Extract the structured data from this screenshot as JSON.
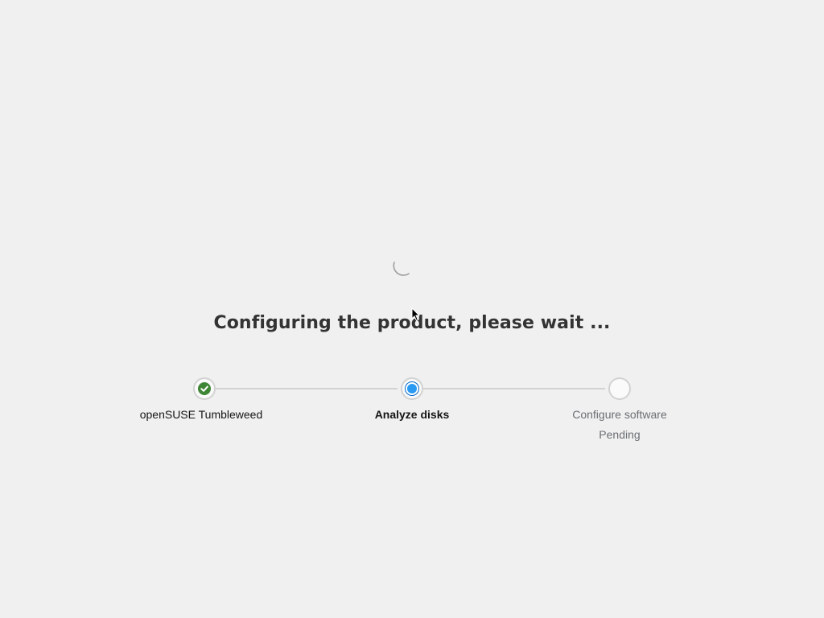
{
  "heading": "Configuring the product, please wait ...",
  "loading_indicator": "spinner-icon",
  "steps": [
    {
      "label": "openSUSE Tumbleweed",
      "status": "complete",
      "icon": "check-circle-icon"
    },
    {
      "label": "Analyze disks",
      "status": "current",
      "icon": "current-step-icon"
    },
    {
      "label": "Configure software",
      "status": "pending",
      "sublabel": "Pending",
      "icon": "pending-step-icon"
    }
  ],
  "colors": {
    "background": "#f0f0f0",
    "complete": "#3e8635",
    "current": "#2b9af3",
    "connector": "#d2d2d2",
    "muted_text": "#6a6e73"
  }
}
